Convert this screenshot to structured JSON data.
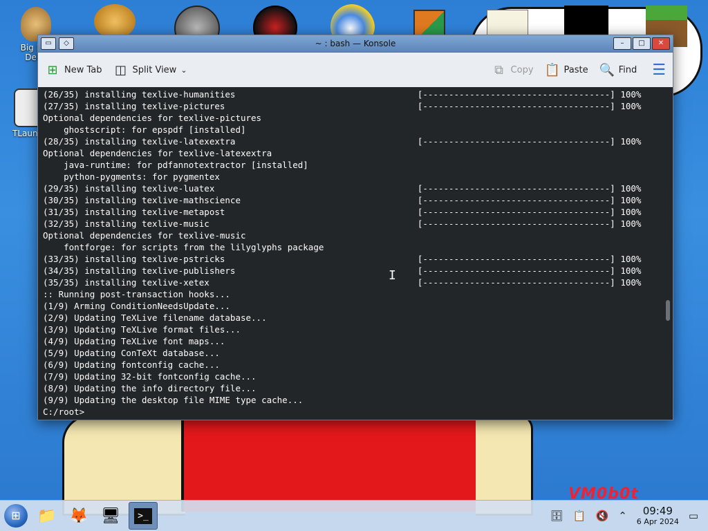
{
  "window": {
    "title": "~ : bash — Konsole",
    "buttons": {
      "minimize": "–",
      "maximize": "□",
      "close": "✕"
    }
  },
  "toolbar": {
    "new_tab": "New Tab",
    "split_view": "Split View",
    "copy": "Copy",
    "paste": "Paste",
    "find": "Find"
  },
  "terminal": {
    "lines": [
      "(26/35) installing texlive-humanities                                   [------------------------------------] 100%",
      "(27/35) installing texlive-pictures                                     [------------------------------------] 100%",
      "Optional dependencies for texlive-pictures",
      "    ghostscript: for epspdf [installed]",
      "(28/35) installing texlive-latexextra                                   [------------------------------------] 100%",
      "Optional dependencies for texlive-latexextra",
      "    java-runtime: for pdfannotextractor [installed]",
      "    python-pygments: for pygmentex",
      "(29/35) installing texlive-luatex                                       [------------------------------------] 100%",
      "(30/35) installing texlive-mathscience                                  [------------------------------------] 100%",
      "(31/35) installing texlive-metapost                                     [------------------------------------] 100%",
      "(32/35) installing texlive-music                                        [------------------------------------] 100%",
      "Optional dependencies for texlive-music",
      "    fontforge: for scripts from the lilyglyphs package",
      "(33/35) installing texlive-pstricks                                     [------------------------------------] 100%",
      "(34/35) installing texlive-publishers                                   [------------------------------------] 100%",
      "(35/35) installing texlive-xetex                                        [------------------------------------] 100%",
      ":: Running post-transaction hooks...",
      "(1/9) Arming ConditionNeedsUpdate...",
      "(2/9) Updating TeXLive filename database...",
      "(3/9) Updating TeXLive format files...",
      "(4/9) Updating TeXLive font maps...",
      "(5/9) Updating ConTeXt database...",
      "(6/9) Updating fontconfig cache...",
      "(7/9) Updating 32-bit fontconfig cache...",
      "(8/9) Updating the info directory file...",
      "(9/9) Updating the desktop file MIME type cache...",
      "C:/root>"
    ]
  },
  "desktop": {
    "icons": [
      {
        "label": "Big M... Del...",
        "icon": "money-bag-icon",
        "color": "#c8a060"
      },
      {
        "label": "TLaun...",
        "icon": "tlauncher-icon",
        "color": "#dcdcdc"
      }
    ],
    "top_icons": [
      {
        "icon": "gear-app-icon",
        "color": "#d89a2a"
      },
      {
        "icon": "gauge-app-icon",
        "color": "#777777"
      },
      {
        "icon": "record-app-icon",
        "color": "#8a1010"
      },
      {
        "icon": "globe-sun-icon",
        "color": "#3a6fd0"
      },
      {
        "icon": "office-grid-icon",
        "color": "#e07a20"
      }
    ],
    "wallpaper_text": "VM0b0t"
  },
  "taskbar": {
    "apps": [
      {
        "icon": "file-manager-icon",
        "glyph": "📁"
      },
      {
        "icon": "firefox-icon",
        "glyph": "🦊"
      },
      {
        "icon": "system-settings-icon",
        "glyph": "🖥"
      },
      {
        "icon": "konsole-icon",
        "glyph": ">_"
      }
    ],
    "clock": {
      "time": "09:49",
      "date": "6 Apr 2024"
    }
  }
}
